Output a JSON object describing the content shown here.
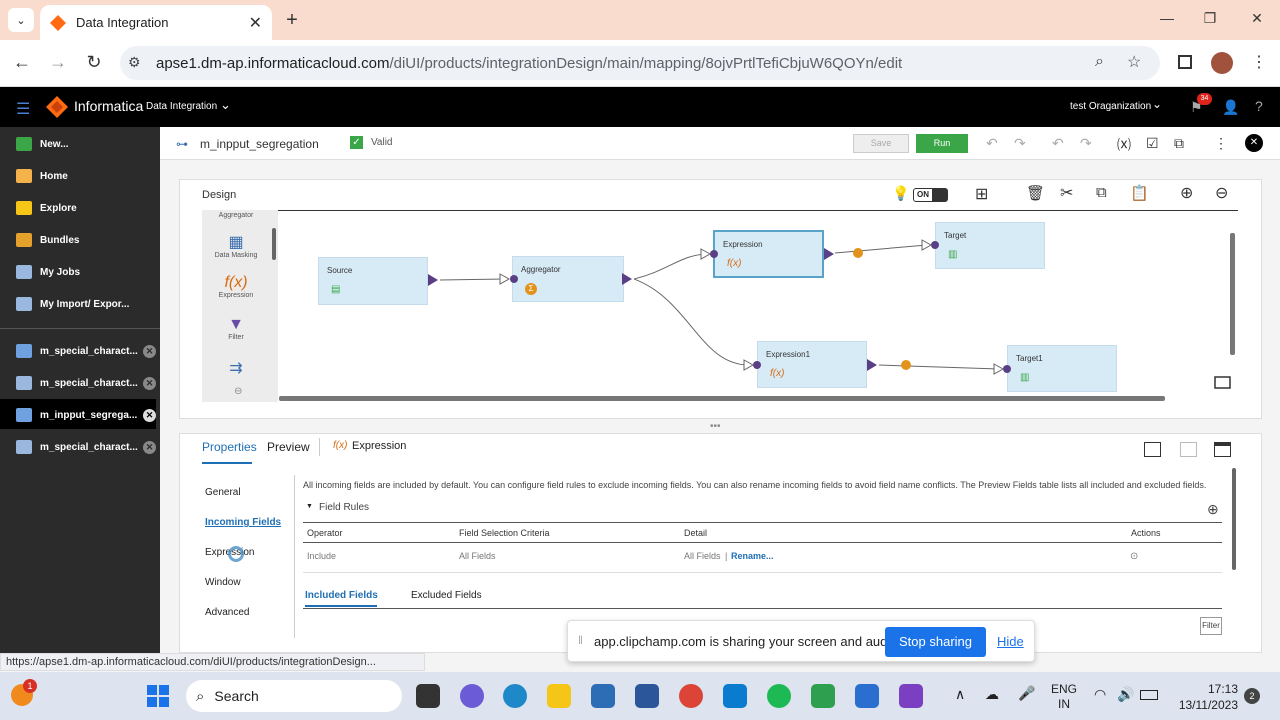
{
  "browser": {
    "tab_title": "Data Integration",
    "url_host": "apse1.dm-ap.informaticacloud.com",
    "url_path": "/diUI/products/integrationDesign/main/mapping/8ojvPrtlTefiCbjuW6QOYn/edit"
  },
  "app": {
    "brand": "Informatica",
    "product": "Data Integration",
    "org": "test Oraganization",
    "notif_count": "34"
  },
  "sidebar": {
    "items": [
      {
        "label": "New..."
      },
      {
        "label": "Home"
      },
      {
        "label": "Explore"
      },
      {
        "label": "Bundles"
      },
      {
        "label": "My Jobs"
      },
      {
        "label": "My Import/ Expor..."
      }
    ],
    "open_tabs": [
      {
        "label": "m_special_charact..."
      },
      {
        "label": "m_special_charact..."
      },
      {
        "label": "m_inpput_segrega..."
      },
      {
        "label": "m_special_charact..."
      }
    ]
  },
  "toolbar": {
    "mapping_name": "m_inpput_segregation",
    "status": "Valid",
    "save_label": "Save",
    "run_label": "Run"
  },
  "design": {
    "title": "Design",
    "toggle_label": "ON",
    "palette": [
      {
        "label": "Aggregator"
      },
      {
        "label": "Data Masking"
      },
      {
        "label": "Expression"
      },
      {
        "label": "Filter"
      }
    ],
    "nodes": {
      "source": "Source",
      "aggregator": "Aggregator",
      "expression": "Expression",
      "target": "Target",
      "expression1": "Expression1",
      "target1": "Target1"
    }
  },
  "properties": {
    "tabs": {
      "properties": "Properties",
      "preview": "Preview",
      "object": "Expression"
    },
    "nav": [
      "General",
      "Incoming Fields",
      "Expression",
      "Window",
      "Advanced"
    ],
    "info": "All incoming fields are included by default. You can configure field rules to exclude incoming fields. You can also rename incoming fields to avoid field name conflicts. The Preview Fields table lists all included and excluded fields.",
    "field_rules_label": "Field Rules",
    "columns": [
      "Operator",
      "Field Selection Criteria",
      "Detail",
      "Actions"
    ],
    "row": {
      "operator": "Include",
      "criteria": "All Fields",
      "detail": "All Fields",
      "rename": "Rename..."
    },
    "subtabs": [
      "Included Fields",
      "Excluded Fields"
    ],
    "filter_label": "Filter"
  },
  "status_url": "https://apse1.dm-ap.informaticacloud.com/diUI/products/integrationDesign...",
  "share": {
    "message": "app.clipchamp.com is sharing your screen and audio.",
    "stop": "Stop sharing",
    "hide": "Hide"
  },
  "taskbar": {
    "search": "Search",
    "lang1": "ENG",
    "lang2": "IN",
    "time": "17:13",
    "date": "13/11/2023",
    "badge": "2",
    "weather_badge": "1"
  }
}
